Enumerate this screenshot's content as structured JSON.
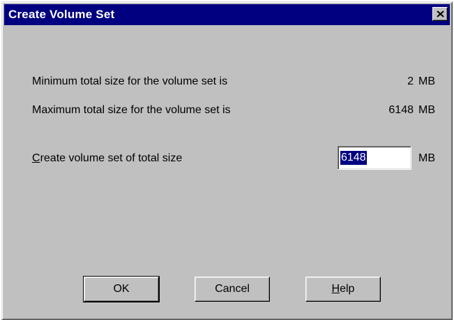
{
  "window": {
    "title": "Create Volume Set",
    "close_glyph": "×"
  },
  "info": {
    "min_label": "Minimum total size for the volume set is",
    "min_value": "2",
    "min_unit": "MB",
    "max_label": "Maximum total size for the volume set is",
    "max_value": "6148",
    "max_unit": "MB"
  },
  "create": {
    "label_mnemonic": "C",
    "label_rest": "reate volume set of total size",
    "input_value": "6148",
    "unit": "MB"
  },
  "buttons": {
    "ok": "OK",
    "cancel": "Cancel",
    "help_mnemonic": "H",
    "help_rest": "elp"
  },
  "colors": {
    "titlebar": "#000080",
    "dialog_bg": "#c0c0c0",
    "selection": "#000080"
  }
}
